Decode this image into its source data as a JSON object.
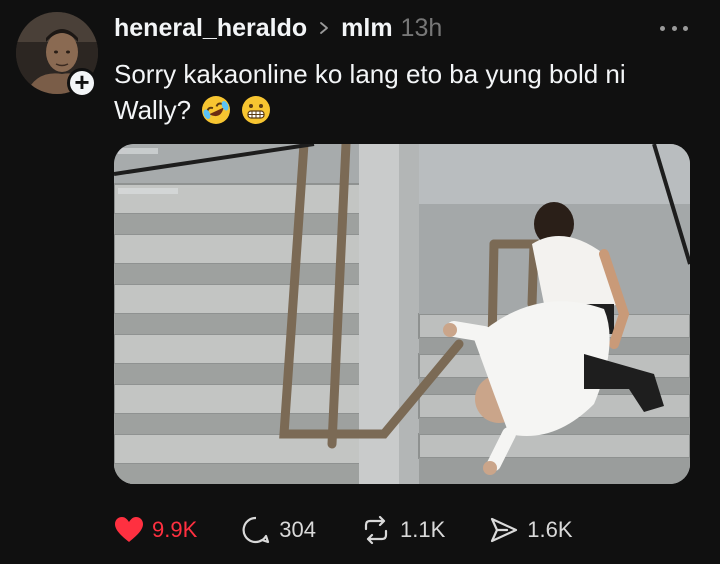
{
  "post": {
    "username": "heneral_heraldo",
    "community": "mlm",
    "timestamp": "13h",
    "caption_text": "Sorry kakaonline ko lang eto ba yung bold ni Wally?",
    "caption_emojis": [
      "rolling-on-floor-laughing-emoji",
      "grimacing-emoji"
    ]
  },
  "actions": {
    "likes": "9.9K",
    "replies": "304",
    "reposts": "1.1K",
    "shares": "1.6K"
  },
  "colors": {
    "background": "#101010",
    "text": "#f3f5f7",
    "muted": "#777777",
    "like_active": "#ff3040"
  }
}
